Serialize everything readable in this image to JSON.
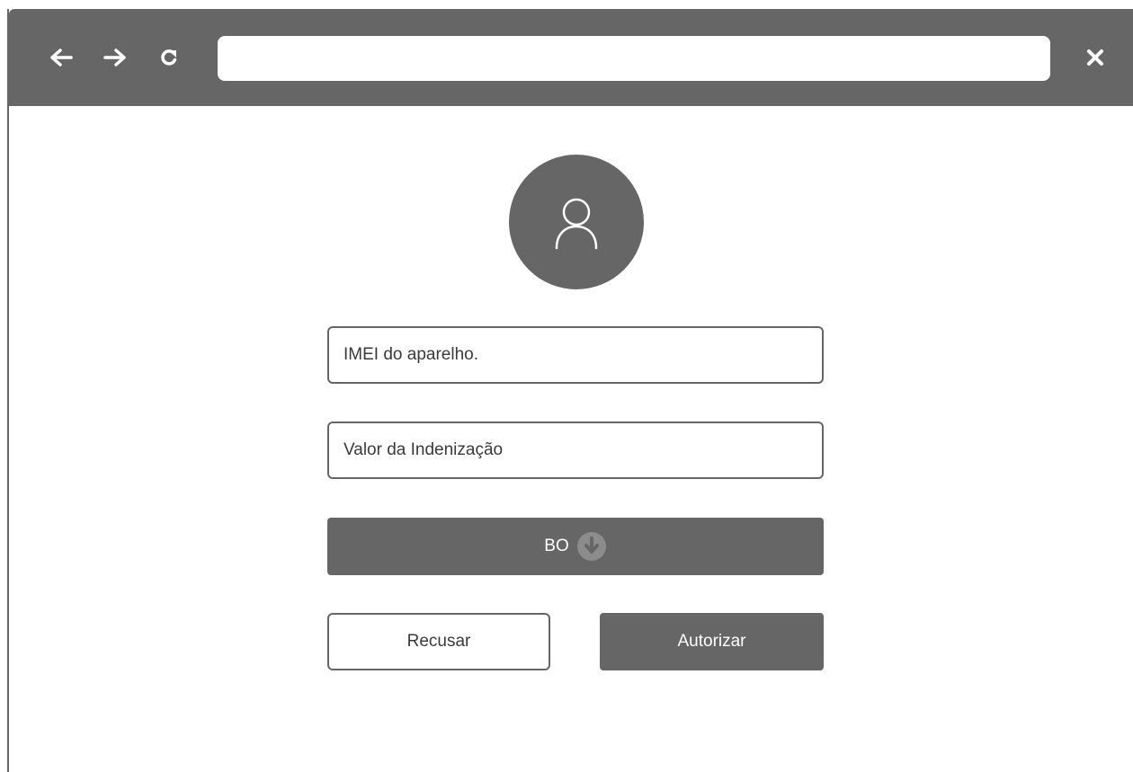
{
  "browser": {
    "back_icon": "arrow-left-icon",
    "forward_icon": "arrow-right-icon",
    "reload_icon": "reload-icon",
    "close_icon": "close-icon",
    "address_value": ""
  },
  "profile": {
    "avatar_icon": "user-icon"
  },
  "form": {
    "imei_placeholder": "IMEI do aparelho.",
    "valor_placeholder": "Valor da Indenização",
    "bo_label": "BO",
    "bo_icon": "download-icon",
    "recusar_label": "Recusar",
    "autorizar_label": "Autorizar"
  },
  "colors": {
    "chrome": "#666666",
    "background": "#ffffff",
    "text": "#3a3a3a"
  }
}
